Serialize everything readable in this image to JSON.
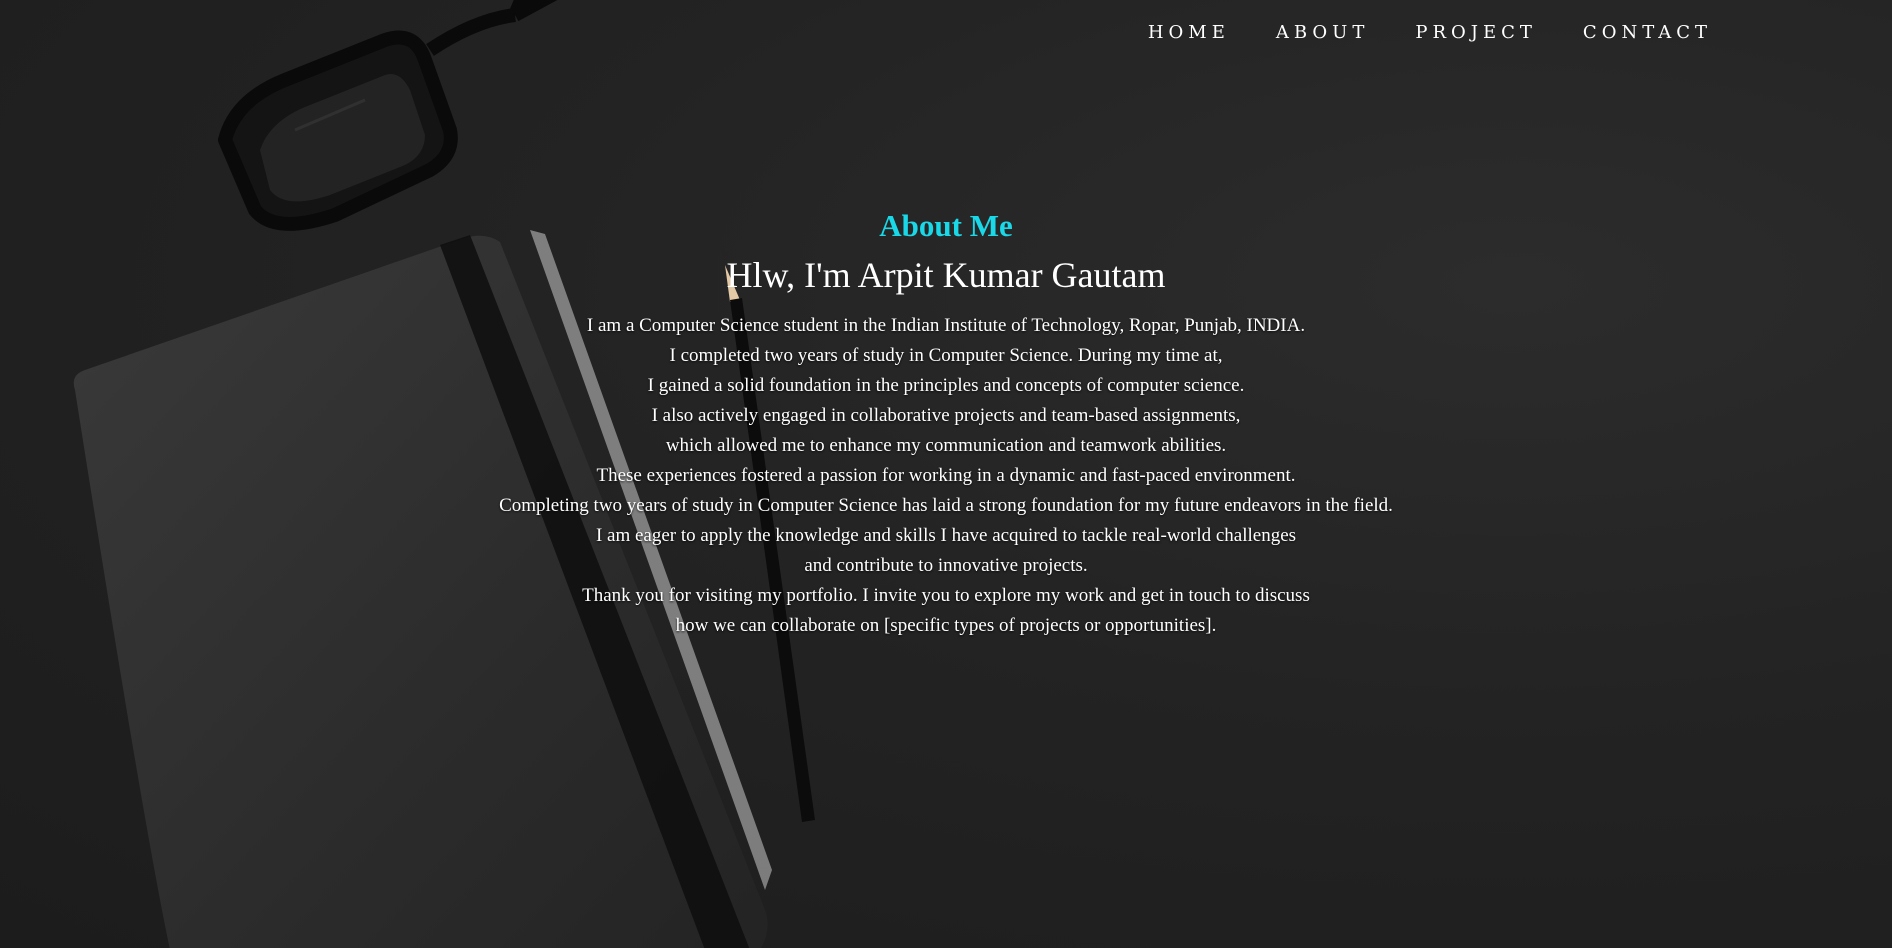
{
  "nav": {
    "items": [
      {
        "label": "HOME"
      },
      {
        "label": "ABOUT"
      },
      {
        "label": "PROJECT"
      },
      {
        "label": "CONTACT"
      }
    ]
  },
  "about": {
    "heading": "About Me",
    "name": "Hlw, I'm Arpit Kumar Gautam",
    "lines": [
      "I am a Computer Science student in the Indian Institute of Technology, Ropar, Punjab, INDIA.",
      "I completed two years of study in Computer Science. During my time at,",
      "I gained a solid foundation in the principles and concepts of computer science.",
      "I also actively engaged in collaborative projects and team-based assignments,",
      "which allowed me to enhance my communication and teamwork abilities.",
      "These experiences fostered a passion for working in a dynamic and fast-paced environment.",
      "Completing two years of study in Computer Science has laid a strong foundation for my future endeavors in the field.",
      "I am eager to apply the knowledge and skills I have acquired to tackle real-world challenges",
      "and contribute to innovative projects.",
      "Thank you for visiting my portfolio. I invite you to explore my work and get in touch to discuss",
      "how we can collaborate on [specific types of projects or opportunities]."
    ]
  },
  "colors": {
    "accent": "#19d8e8",
    "background": "#222222",
    "text": "#ffffff"
  }
}
